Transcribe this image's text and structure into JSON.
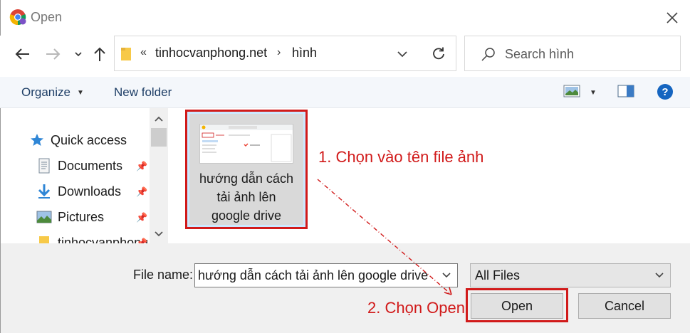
{
  "window": {
    "title": "Open",
    "close_icon": "close-icon"
  },
  "address": {
    "chevron": "«",
    "segments": [
      "tinhocvanphong.net",
      "hình"
    ],
    "separator": "›"
  },
  "search": {
    "placeholder": "Search hình"
  },
  "toolbar": {
    "organize_label": "Organize",
    "new_folder_label": "New folder"
  },
  "sidebar": {
    "items": [
      {
        "label": "Quick access",
        "icon": "star-icon"
      },
      {
        "label": "Documents",
        "icon": "documents-icon",
        "pinned": true
      },
      {
        "label": "Downloads",
        "icon": "download-icon",
        "pinned": true
      },
      {
        "label": "Pictures",
        "icon": "pictures-icon",
        "pinned": true
      },
      {
        "label": "tinhocvanphong",
        "icon": "folder-icon",
        "pinned": true
      }
    ]
  },
  "files": [
    {
      "label_lines": [
        "hướng dẫn cách",
        "tải ảnh lên",
        "google drive"
      ],
      "selected": true
    }
  ],
  "annotations": {
    "step1": "1. Chọn vào tên file ảnh",
    "step2": "2. Chọn Open",
    "color": "#d11a1a"
  },
  "footer": {
    "file_name_label": "File name:",
    "file_name_value": "hướng dẫn cách tải ảnh lên google drive",
    "file_type_value": "All Files",
    "open_label": "Open",
    "cancel_label": "Cancel"
  },
  "colors": {
    "toolbar_text": "#1e3e66",
    "help_blue": "#1565c0",
    "selection": "#cce8ff"
  }
}
